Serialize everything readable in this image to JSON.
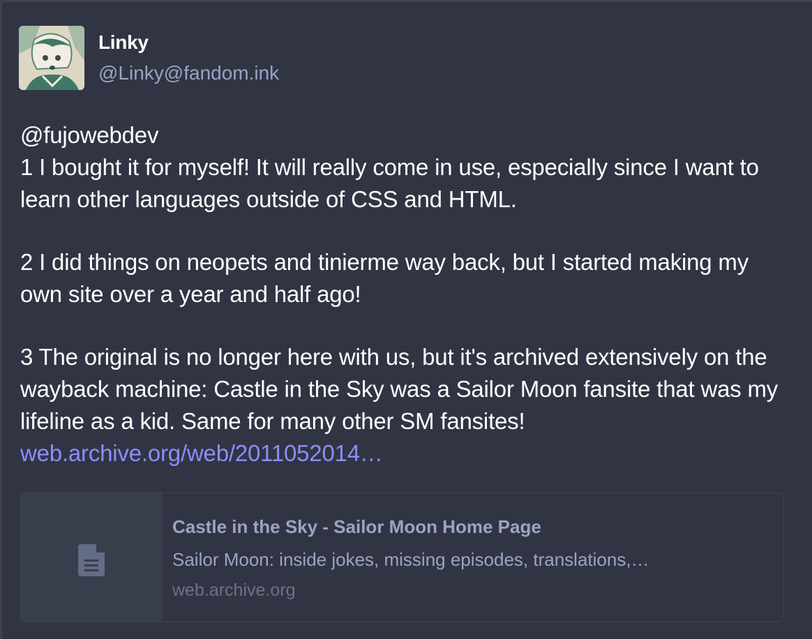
{
  "author": {
    "display_name": "Linky",
    "account": "@Linky@fandom.ink",
    "avatar_icon": "manga-girl-avatar"
  },
  "status": {
    "mention": "@fujowebdev",
    "paragraph_1": "1 I bought it for myself! It will really come in use, especially since I want to learn other languages outside of CSS and HTML.",
    "paragraph_2": "2 I did things on neopets and tinierme way back, but I started making my own site over a year and half ago!",
    "paragraph_3": "3 The original is no longer here with us, but it's archived extensively on the wayback machine: Castle in the Sky was a Sailor Moon fansite that was my lifeline as a kid. Same for many other SM fansites!",
    "link_text": "web.archive.org/web/2011052014…"
  },
  "card": {
    "icon": "document-icon",
    "title": "Castle in the Sky - Sailor Moon Home Page",
    "description": "Sailor Moon: inside jokes, missing episodes, translations,…",
    "host": "web.archive.org"
  },
  "colors": {
    "background": "#313543",
    "link": "#8c8dff",
    "muted": "#9aa4c4"
  }
}
